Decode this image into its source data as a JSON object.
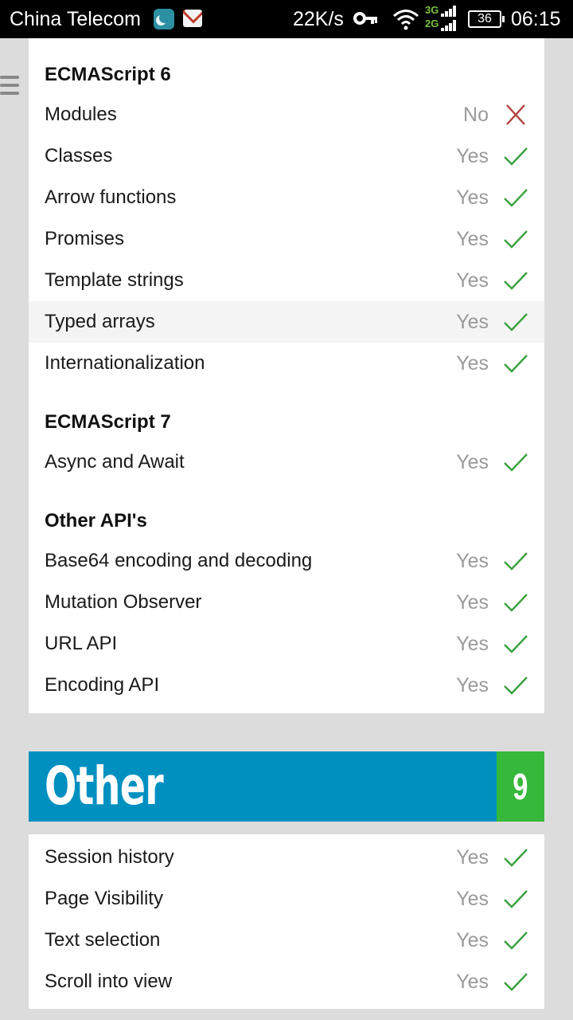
{
  "status_bar": {
    "carrier": "China Telecom",
    "speed": "22K/s",
    "network_top": "3G",
    "network_bottom": "2G",
    "battery": "36",
    "time": "06:15"
  },
  "icons": {
    "menu": "hamburger-menu-icon",
    "yes": "check-icon",
    "no": "cross-icon"
  },
  "colors": {
    "check": "#3aa13d",
    "cross": "#b0413e",
    "banner_bg": "#0090c0",
    "count_bg": "#36b83a"
  },
  "sections": [
    {
      "title": "ECMAScript 6",
      "items": [
        {
          "name": "Modules",
          "value": "No",
          "status": "no"
        },
        {
          "name": "Classes",
          "value": "Yes",
          "status": "yes"
        },
        {
          "name": "Arrow functions",
          "value": "Yes",
          "status": "yes"
        },
        {
          "name": "Promises",
          "value": "Yes",
          "status": "yes"
        },
        {
          "name": "Template strings",
          "value": "Yes",
          "status": "yes"
        },
        {
          "name": "Typed arrays",
          "value": "Yes",
          "status": "yes"
        },
        {
          "name": "Internationalization",
          "value": "Yes",
          "status": "yes"
        }
      ]
    },
    {
      "title": "ECMAScript 7",
      "items": [
        {
          "name": "Async and Await",
          "value": "Yes",
          "status": "yes"
        }
      ]
    },
    {
      "title": "Other API's",
      "items": [
        {
          "name": "Base64 encoding and decoding",
          "value": "Yes",
          "status": "yes"
        },
        {
          "name": "Mutation Observer",
          "value": "Yes",
          "status": "yes"
        },
        {
          "name": "URL API",
          "value": "Yes",
          "status": "yes"
        },
        {
          "name": "Encoding API",
          "value": "Yes",
          "status": "yes"
        }
      ]
    }
  ],
  "other": {
    "title": "Other",
    "count": "9",
    "items": [
      {
        "name": "Session history",
        "value": "Yes",
        "status": "yes"
      },
      {
        "name": "Page Visibility",
        "value": "Yes",
        "status": "yes"
      },
      {
        "name": "Text selection",
        "value": "Yes",
        "status": "yes"
      },
      {
        "name": "Scroll into view",
        "value": "Yes",
        "status": "yes"
      }
    ]
  }
}
